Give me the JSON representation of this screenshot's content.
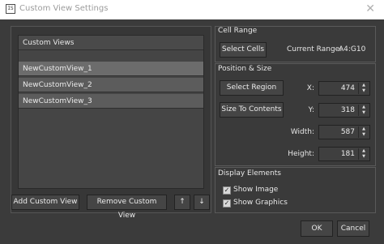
{
  "window": {
    "title": "Custom View Settings",
    "close_glyph": "✕",
    "app_icon_text": "IS"
  },
  "list": {
    "header": "Custom Views",
    "items": [
      "NewCustomView_1",
      "NewCustomView_2",
      "NewCustomView_3"
    ]
  },
  "left_buttons": {
    "add": "Add Custom View",
    "remove": "Remove Custom View",
    "up": "↑",
    "down": "↓"
  },
  "cell_range": {
    "section": "Cell Range",
    "select_cells": "Select Cells",
    "current_range_label": "Current Range:",
    "current_range_value": "A4:G10"
  },
  "position_size": {
    "section": "Position & Size",
    "select_region": "Select Region",
    "size_to_contents": "Size To Contents",
    "x_label": "X:",
    "x_value": "474",
    "y_label": "Y:",
    "y_value": "318",
    "width_label": "Width:",
    "width_value": "587",
    "height_label": "Height:",
    "height_value": "181"
  },
  "display_elements": {
    "section": "Display Elements",
    "show_image": "Show Image",
    "show_image_checked": true,
    "show_graphics": "Show Graphics",
    "show_graphics_checked": true,
    "check_glyph": "✓"
  },
  "footer": {
    "ok": "OK",
    "cancel": "Cancel"
  },
  "spin_glyphs": {
    "up": "▲",
    "down": "▼"
  }
}
